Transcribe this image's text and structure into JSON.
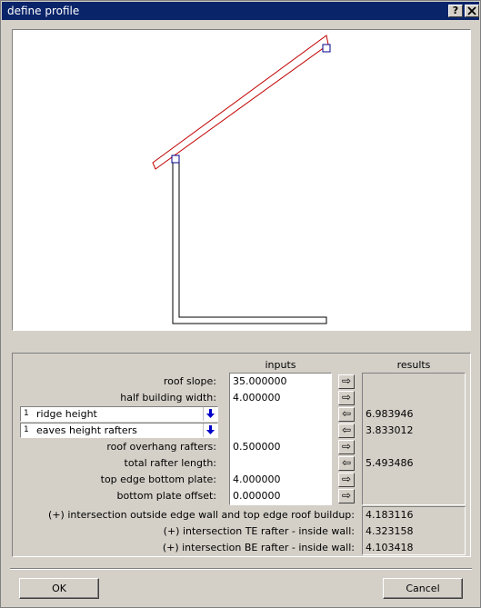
{
  "window": {
    "title": "define profile",
    "help_label": "?",
    "close_label": "X"
  },
  "headers": {
    "inputs": "inputs",
    "results": "results"
  },
  "rows": [
    {
      "label": "roof slope:",
      "input": "35.000000",
      "result": "",
      "arrow": "right"
    },
    {
      "label": "half building width:",
      "input": "4.000000",
      "result": "",
      "arrow": "right"
    },
    {
      "label": "",
      "input": "",
      "result": "6.983946",
      "arrow": "left"
    },
    {
      "label": "",
      "input": "",
      "result": "3.833012",
      "arrow": "left"
    },
    {
      "label": "roof overhang rafters:",
      "input": "0.500000",
      "result": "",
      "arrow": "right"
    },
    {
      "label": "total rafter length:",
      "input": "",
      "result": "5.493486",
      "arrow": "left"
    },
    {
      "label": "top edge bottom plate:",
      "input": "4.000000",
      "result": "",
      "arrow": "right"
    },
    {
      "label": "bottom plate offset:",
      "input": "0.000000",
      "result": "",
      "arrow": "right"
    }
  ],
  "selects": [
    {
      "num": "1",
      "label": "ridge height",
      "icon": "blue-down-arrow-icon"
    },
    {
      "num": "1",
      "label": "eaves height rafters",
      "icon": "blue-down-arrow-icon"
    }
  ],
  "intersections": [
    {
      "label": "(+) intersection outside edge wall and top edge roof buildup:",
      "value": "4.183116"
    },
    {
      "label": "(+) intersection TE rafter - inside wall:",
      "value": "4.323158"
    },
    {
      "label": "(+) intersection BE rafter - inside wall:",
      "value": "4.103418"
    }
  ],
  "buttons": {
    "ok": "OK",
    "cancel": "Cancel"
  },
  "colors": {
    "title_bg": "#0a246a",
    "rafter_stroke": "#c00000",
    "handle_stroke": "#00008b",
    "dropdown_arrow": "#0000c8"
  }
}
